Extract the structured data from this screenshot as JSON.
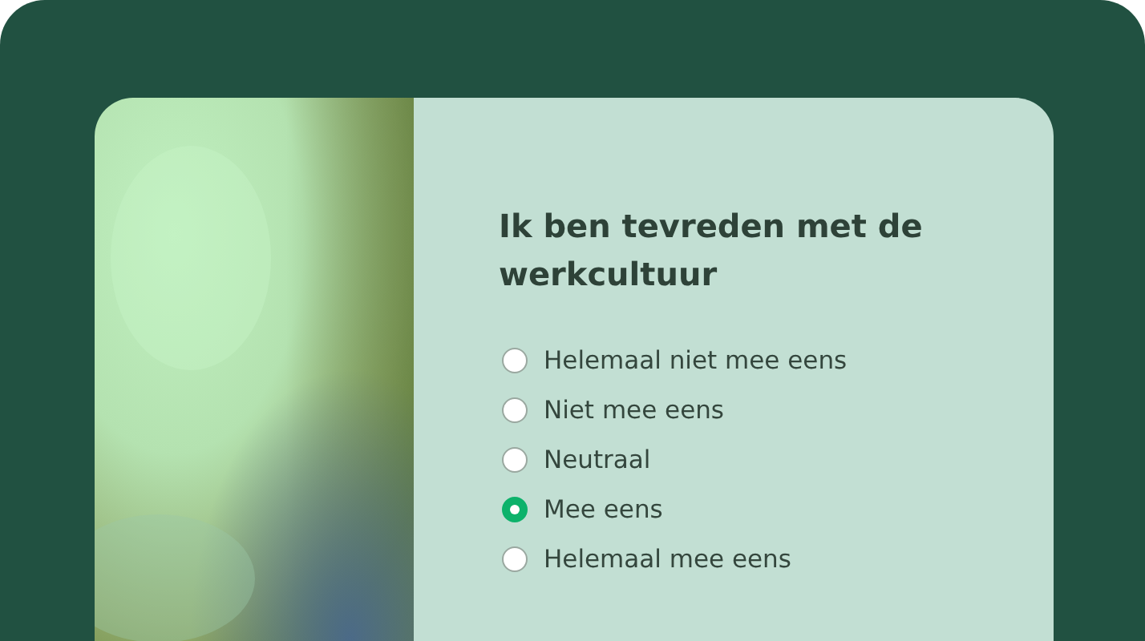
{
  "survey": {
    "question": "Ik ben tevreden met de werkcultuur",
    "options": [
      {
        "label": "Helemaal niet mee eens",
        "selected": false
      },
      {
        "label": "Niet mee eens",
        "selected": false
      },
      {
        "label": "Neutraal",
        "selected": false
      },
      {
        "label": "Mee eens",
        "selected": true
      },
      {
        "label": "Helemaal mee eens",
        "selected": false
      }
    ]
  }
}
